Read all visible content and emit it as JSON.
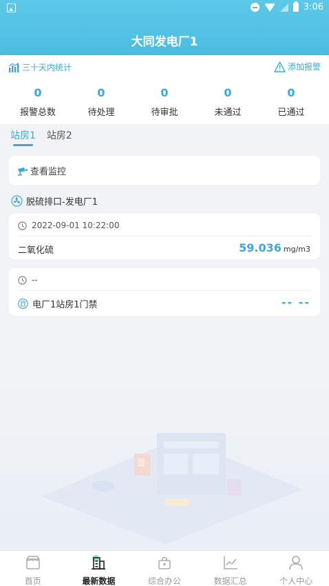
{
  "status_bar": {
    "time": "3:06"
  },
  "header": {
    "title": "大同发电厂1"
  },
  "stats": {
    "link_label": "三十天内统计",
    "add_alarm_label": "添加报警",
    "items": [
      {
        "value": "0",
        "label": "报警总数"
      },
      {
        "value": "0",
        "label": "待处理"
      },
      {
        "value": "0",
        "label": "待审批"
      },
      {
        "value": "0",
        "label": "未通过"
      },
      {
        "value": "0",
        "label": "已通过"
      }
    ]
  },
  "tabs": [
    {
      "label": "站房1",
      "active": true
    },
    {
      "label": "站房2",
      "active": false
    }
  ],
  "monitor": {
    "label": "查看监控"
  },
  "section": {
    "title": "脱硫排口-发电厂1"
  },
  "cards": [
    {
      "time": "2022-09-01 10:22:00",
      "name": "二氧化硫",
      "value": "59.036",
      "unit": "mg/m3"
    },
    {
      "time": "--",
      "name": "电厂1站房1门禁",
      "value": "-- --"
    }
  ],
  "bottom_nav": [
    {
      "label": "首页",
      "icon": "home-icon",
      "active": false
    },
    {
      "label": "最新数据",
      "icon": "building-icon",
      "active": true
    },
    {
      "label": "综合办公",
      "icon": "briefcase-icon",
      "active": false
    },
    {
      "label": "数据汇总",
      "icon": "line-chart-icon",
      "active": false
    },
    {
      "label": "个人中心",
      "icon": "user-icon",
      "active": false
    }
  ],
  "colors": {
    "accent": "#3ba9d8",
    "header": "#4bbde2"
  }
}
